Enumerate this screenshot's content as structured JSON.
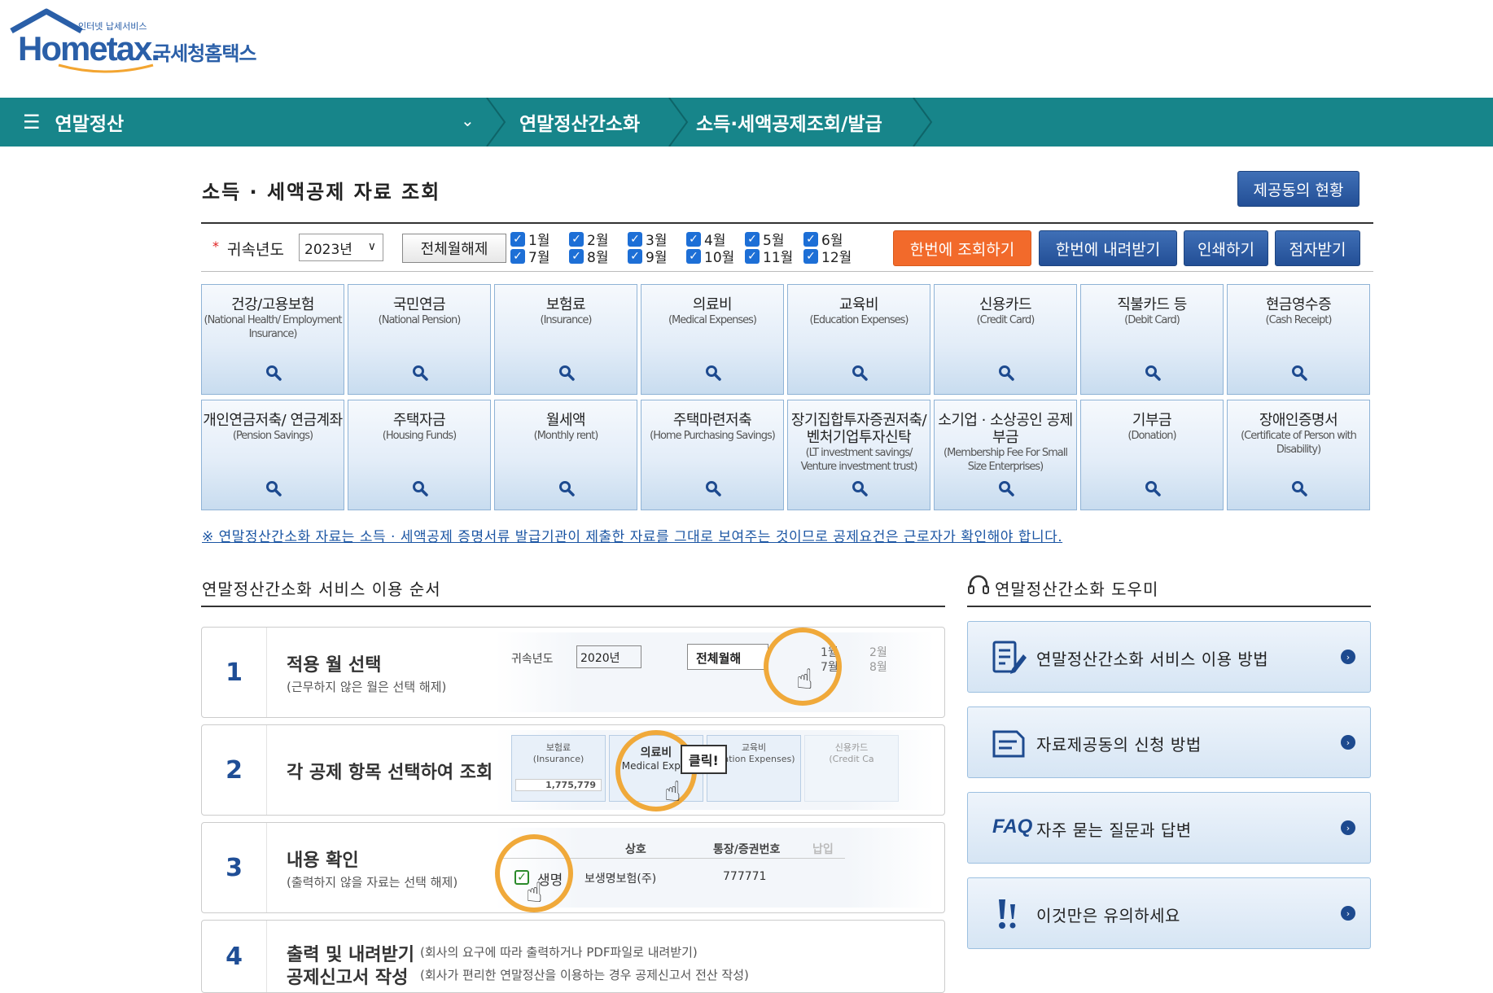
{
  "header": {
    "brand": "Hometax.",
    "brand_sub": "인터넷 납세서비스",
    "brand_kr": "국세청홈택스"
  },
  "nav": {
    "menu_title": "연말정산",
    "crumbs": [
      "연말정산간소화",
      "소득·세액공제조회/발급"
    ],
    "menu_icon": "hamburger-icon",
    "chevron_icon": "chevron-down-icon"
  },
  "page": {
    "title": "소득 · 세액공제 자료 조회",
    "provider_status_btn": "제공동의 현황"
  },
  "filter": {
    "year_label": "귀속년도",
    "year_value": "2023년",
    "clear_months_btn": "전체월해제",
    "months": [
      "1월",
      "2월",
      "3월",
      "4월",
      "5월",
      "6월",
      "7월",
      "8월",
      "9월",
      "10월",
      "11월",
      "12월"
    ],
    "months_checked": [
      true,
      true,
      true,
      true,
      true,
      true,
      true,
      true,
      true,
      true,
      true,
      true
    ],
    "query_all_btn": "한번에 조회하기",
    "download_all_btn": "한번에 내려받기",
    "print_btn": "인쇄하기",
    "braille_btn": "점자받기"
  },
  "categories": [
    {
      "ko": "건강/고용보험",
      "en": "(National Health/ Employment Insurance)"
    },
    {
      "ko": "국민연금",
      "en": "(National Pension)"
    },
    {
      "ko": "보험료",
      "en": "(Insurance)"
    },
    {
      "ko": "의료비",
      "en": "(Medical Expenses)"
    },
    {
      "ko": "교육비",
      "en": "(Education Expenses)"
    },
    {
      "ko": "신용카드",
      "en": "(Credit Card)"
    },
    {
      "ko": "직불카드 등",
      "en": "(Debit Card)"
    },
    {
      "ko": "현금영수증",
      "en": "(Cash Receipt)"
    },
    {
      "ko": "개인연금저축/ 연금계좌",
      "en": "(Pension Savings)"
    },
    {
      "ko": "주택자금",
      "en": "(Housing Funds)"
    },
    {
      "ko": "월세액",
      "en": "(Monthly rent)"
    },
    {
      "ko": "주택마련저축",
      "en": "(Home Purchasing Savings)"
    },
    {
      "ko": "장기집합투자증권저축/ 벤처기업투자신탁",
      "en": "(LT investment savings/ Venture investment trust)"
    },
    {
      "ko": "소기업 · 소상공인 공제부금",
      "en": "(Membership Fee For Small Size Enterprises)"
    },
    {
      "ko": "기부금",
      "en": "(Donation)"
    },
    {
      "ko": "장애인증명서",
      "en": "(Certificate of Person with Disability)"
    }
  ],
  "notice": "※ 연말정산간소화 자료는 소득 · 세액공제 증명서류 발급기관이 제출한 자료를 그대로 보여주는 것이므로 공제요건은 근로자가 확인해야 합니다.",
  "steps_section": {
    "title": "연말정산간소화 서비스 이용 순서",
    "steps": [
      {
        "num": "1",
        "title": "적용 월 선택",
        "desc": "(근무하지 않은 월은 선택 해제)"
      },
      {
        "num": "2",
        "title": "각 공제 항목 선택하여 조회",
        "desc": ""
      },
      {
        "num": "3",
        "title": "내용 확인",
        "desc": "(출력하지 않을 자료는 선택 해제)"
      },
      {
        "num": "4",
        "title": "출력 및 내려받기",
        "title2": "공제신고서 작성",
        "desc": "(회사의 요구에 따라 출력하거나 PDF파일로 내려받기)",
        "desc2": "(회사가 편리한 연말정산을 이용하는 경우 공제신고서 전산 작성)"
      }
    ],
    "demo1": {
      "year_label": "귀속년도",
      "year_value": "2020년",
      "clear_btn": "전체월해",
      "m1": "1월",
      "m2": "2월",
      "m7": "7월",
      "m8": "8월"
    },
    "demo2": {
      "c1": "보험료",
      "c1en": "(Insurance)",
      "c1val": "1,775,779",
      "c2": "의료비",
      "c2en": "Medical Exper",
      "c3": "교육비",
      "c3en": "ucation Expenses)",
      "c4": "신용카드",
      "c4en": "(Credit Ca",
      "click": "클릭!"
    },
    "demo3": {
      "h1": "상호",
      "h2": "통장/증권번호",
      "h3": "납입",
      "row_name": "생명",
      "row_company": "보생명보험(주)",
      "row_no": "777771"
    }
  },
  "helper_section": {
    "title": "연말정산간소화 도우미",
    "items": [
      {
        "label": "연말정산간소화 서비스 이용 방법",
        "icon": "document-pen-icon"
      },
      {
        "label": "자료제공동의 신청 방법",
        "icon": "form-icon"
      },
      {
        "label": "자주 묻는 질문과 답변",
        "badge": "FAQ",
        "icon": "faq-icon"
      },
      {
        "label": "이것만은 유의하세요",
        "icon": "exclamation-icon"
      }
    ]
  }
}
